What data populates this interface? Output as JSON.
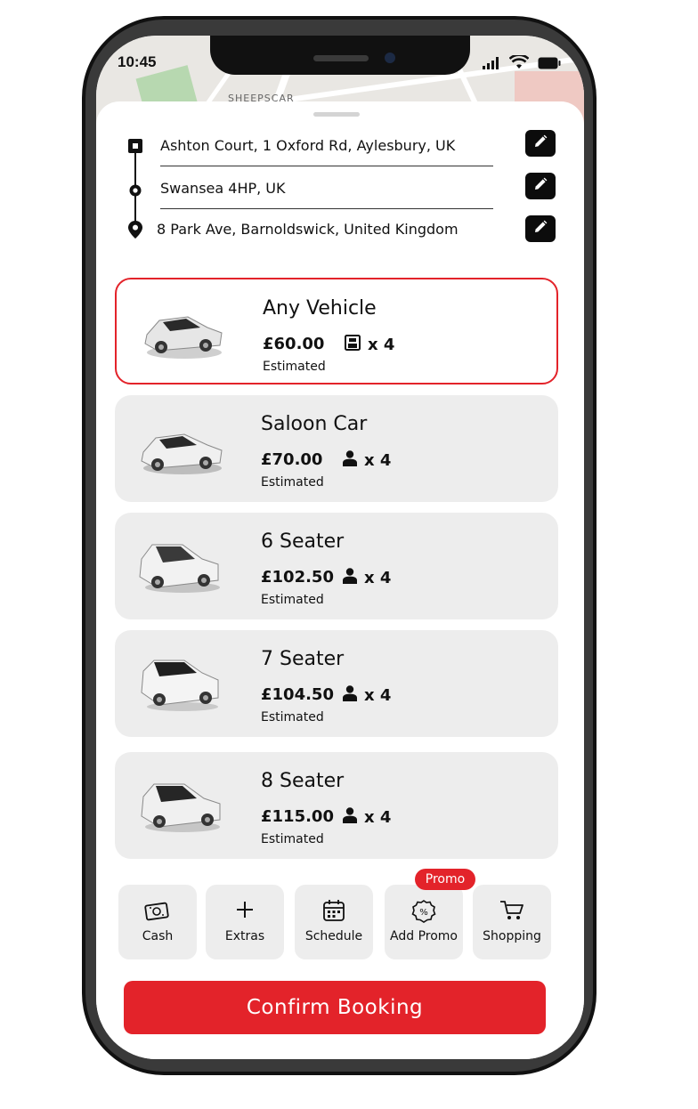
{
  "status_bar": {
    "time": "10:45",
    "map_label": "SHEEPSCAR"
  },
  "route": {
    "stops": [
      {
        "label": "Ashton Court, 1 Oxford Rd, Aylesbury, UK",
        "icon": "pickup-square-icon"
      },
      {
        "label": "Swansea 4HP, UK",
        "icon": "waypoint-dot-icon"
      },
      {
        "label": "8 Park Ave, Barnoldswick, United Kingdom",
        "icon": "destination-pin-icon"
      }
    ],
    "edit_icon": "pencil-icon"
  },
  "vehicles": [
    {
      "name": "Any Vehicle",
      "price": "£60.00",
      "capacity": "x 4",
      "note": "Estimated",
      "selected": true,
      "capacity_icon": "luggage-icon"
    },
    {
      "name": "Saloon Car",
      "price": "£70.00",
      "capacity": "x 4",
      "note": "Estimated",
      "selected": false,
      "capacity_icon": "person-icon"
    },
    {
      "name": "6 Seater",
      "price": "£102.50",
      "capacity": "x 4",
      "note": "Estimated",
      "selected": false,
      "capacity_icon": "person-icon"
    },
    {
      "name": "7 Seater",
      "price": "£104.50",
      "capacity": "x 4",
      "note": "Estimated",
      "selected": false,
      "capacity_icon": "person-icon"
    },
    {
      "name": "8 Seater",
      "price": "£115.00",
      "capacity": "x 4",
      "note": "Estimated",
      "selected": false,
      "capacity_icon": "person-icon"
    }
  ],
  "actions": [
    {
      "label": "Cash",
      "icon": "cash-icon"
    },
    {
      "label": "Extras",
      "icon": "plus-icon"
    },
    {
      "label": "Schedule",
      "icon": "calendar-icon"
    },
    {
      "label": "Add Promo",
      "icon": "promo-badge-icon",
      "badge": "Promo"
    },
    {
      "label": "Shopping",
      "icon": "cart-icon"
    }
  ],
  "confirm_label": "Confirm Booking",
  "colors": {
    "accent": "#e3232a",
    "card_bg": "#ededed",
    "dark": "#0c0c0c"
  }
}
